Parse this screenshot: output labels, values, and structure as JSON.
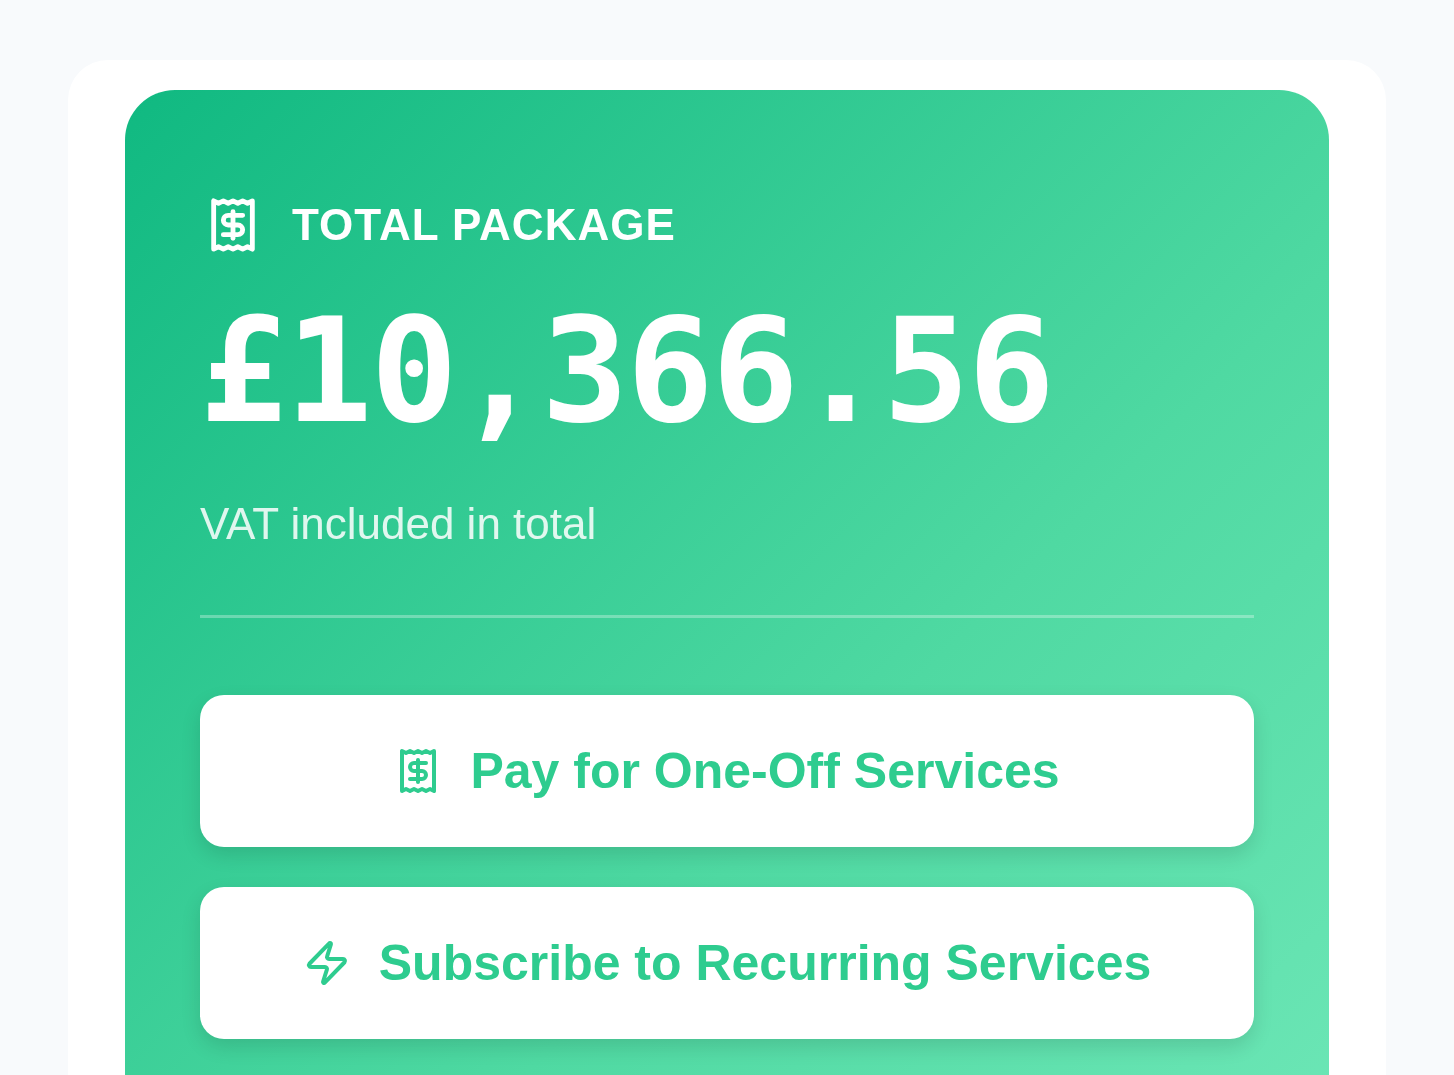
{
  "summary": {
    "label": "TOTAL PACKAGE",
    "amount": "£10,366.56",
    "note": "VAT included in total"
  },
  "actions": [
    {
      "kind": "receipt",
      "label": "Pay for One-Off Services"
    },
    {
      "kind": "bolt",
      "label": "Subscribe to Recurring Services"
    }
  ]
}
